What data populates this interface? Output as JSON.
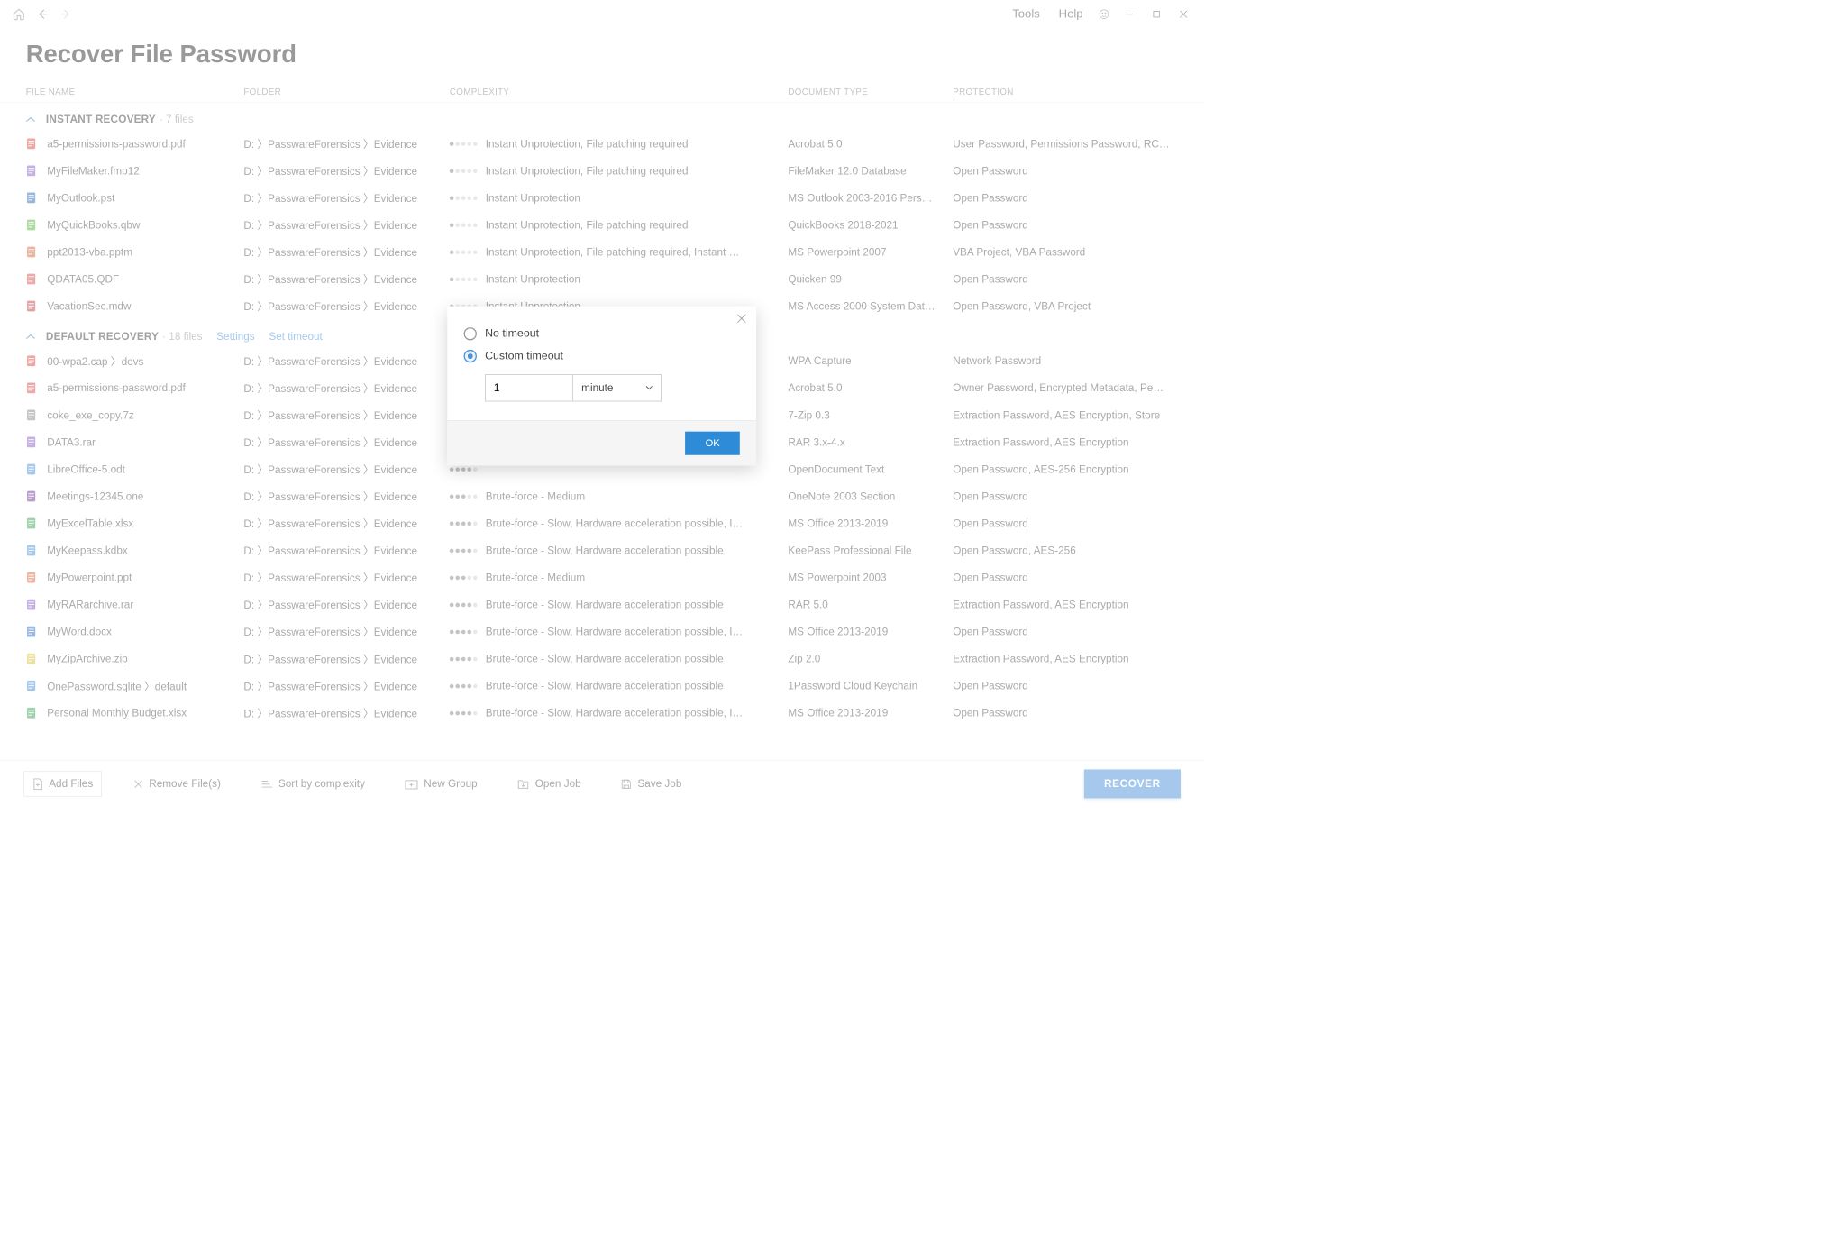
{
  "menu": {
    "tools": "Tools",
    "help": "Help"
  },
  "page_title": "Recover File Password",
  "columns": {
    "file_name": "FILE NAME",
    "folder": "FOLDER",
    "complexity": "COMPLEXITY",
    "document_type": "DOCUMENT TYPE",
    "protection": "PROTECTION"
  },
  "groups": [
    {
      "name": "INSTANT RECOVERY",
      "count": "· 7 files",
      "links": [],
      "rows": [
        {
          "icon": "pdf",
          "file": "a5-permissions-password.pdf",
          "folder": "D: 〉PasswareForensics 〉Evidence",
          "dots": 1,
          "complexity": "Instant Unprotection, File patching required",
          "doctype": "Acrobat 5.0",
          "protection": "User Password, Permissions Password, RC…"
        },
        {
          "icon": "filemaker",
          "file": "MyFileMaker.fmp12",
          "folder": "D: 〉PasswareForensics 〉Evidence",
          "dots": 1,
          "complexity": "Instant Unprotection, File patching required",
          "doctype": "FileMaker 12.0 Database",
          "protection": "Open Password"
        },
        {
          "icon": "outlook",
          "file": "MyOutlook.pst",
          "folder": "D: 〉PasswareForensics 〉Evidence",
          "dots": 1,
          "complexity": "Instant Unprotection",
          "doctype": "MS Outlook 2003-2016 Pers…",
          "protection": "Open Password"
        },
        {
          "icon": "qb",
          "file": "MyQuickBooks.qbw",
          "folder": "D: 〉PasswareForensics 〉Evidence",
          "dots": 1,
          "complexity": "Instant Unprotection, File patching required",
          "doctype": "QuickBooks 2018-2021",
          "protection": "Open Password"
        },
        {
          "icon": "ppt",
          "file": "ppt2013-vba.pptm",
          "folder": "D: 〉PasswareForensics 〉Evidence",
          "dots": 1,
          "complexity": "Instant Unprotection, File patching required, Instant …",
          "doctype": "MS Powerpoint 2007",
          "protection": "VBA Project, VBA Password"
        },
        {
          "icon": "quicken",
          "file": "QDATA05.QDF",
          "folder": "D: 〉PasswareForensics 〉Evidence",
          "dots": 1,
          "complexity": "Instant Unprotection",
          "doctype": "Quicken 99",
          "protection": "Open Password"
        },
        {
          "icon": "access",
          "file": "VacationSec.mdw",
          "folder": "D: 〉PasswareForensics 〉Evidence",
          "dots": 1,
          "complexity": "Instant Unprotection",
          "doctype": "MS Access 2000 System Dat…",
          "protection": "Open Password, VBA Project"
        }
      ]
    },
    {
      "name": "DEFAULT RECOVERY",
      "count": "· 18 files",
      "links": [
        "Settings",
        "Set timeout"
      ],
      "rows": [
        {
          "icon": "wifi",
          "file": "00-wpa2.cap 〉devs",
          "folder": "D: 〉PasswareForensics 〉Evidence",
          "dots": 4,
          "complexity": "",
          "doctype": "WPA Capture",
          "protection": "Network Password"
        },
        {
          "icon": "pdf",
          "file": "a5-permissions-password.pdf",
          "folder": "D: 〉PasswareForensics 〉Evidence",
          "dots": 4,
          "complexity": "",
          "doctype": "Acrobat 5.0",
          "protection": "Owner Password, Encrypted Metadata, Pe…"
        },
        {
          "icon": "archive",
          "file": "coke_exe_copy.7z",
          "folder": "D: 〉PasswareForensics 〉Evidence",
          "dots": 4,
          "complexity": "",
          "doctype": "7-Zip 0.3",
          "protection": "Extraction Password, AES Encryption, Store"
        },
        {
          "icon": "rar",
          "file": "DATA3.rar",
          "folder": "D: 〉PasswareForensics 〉Evidence",
          "dots": 4,
          "complexity": "",
          "doctype": "RAR 3.x-4.x",
          "protection": "Extraction Password, AES Encryption"
        },
        {
          "icon": "odt",
          "file": "LibreOffice-5.odt",
          "folder": "D: 〉PasswareForensics 〉Evidence",
          "dots": 4,
          "complexity": "",
          "doctype": "OpenDocument Text",
          "protection": "Open Password, AES-256 Encryption"
        },
        {
          "icon": "onenote",
          "file": "Meetings-12345.one",
          "folder": "D: 〉PasswareForensics 〉Evidence",
          "dots": 3,
          "complexity": "Brute-force - Medium",
          "doctype": "OneNote 2003 Section",
          "protection": "Open Password"
        },
        {
          "icon": "excel",
          "file": "MyExcelTable.xlsx",
          "folder": "D: 〉PasswareForensics 〉Evidence",
          "dots": 4,
          "complexity": "Brute-force - Slow, Hardware acceleration possible, I…",
          "doctype": "MS Office 2013-2019",
          "protection": "Open Password"
        },
        {
          "icon": "keepass",
          "file": "MyKeepass.kdbx",
          "folder": "D: 〉PasswareForensics 〉Evidence",
          "dots": 4,
          "complexity": "Brute-force - Slow, Hardware acceleration possible",
          "doctype": "KeePass Professional File",
          "protection": "Open Password, AES-256"
        },
        {
          "icon": "ppt",
          "file": "MyPowerpoint.ppt",
          "folder": "D: 〉PasswareForensics 〉Evidence",
          "dots": 3,
          "complexity": "Brute-force - Medium",
          "doctype": "MS Powerpoint 2003",
          "protection": "Open Password"
        },
        {
          "icon": "rar",
          "file": "MyRARarchive.rar",
          "folder": "D: 〉PasswareForensics 〉Evidence",
          "dots": 4,
          "complexity": "Brute-force - Slow, Hardware acceleration possible",
          "doctype": "RAR 5.0",
          "protection": "Extraction Password, AES Encryption"
        },
        {
          "icon": "word",
          "file": "MyWord.docx",
          "folder": "D: 〉PasswareForensics 〉Evidence",
          "dots": 4,
          "complexity": "Brute-force - Slow, Hardware acceleration possible, I…",
          "doctype": "MS Office 2013-2019",
          "protection": "Open Password"
        },
        {
          "icon": "zip",
          "file": "MyZipArchive.zip",
          "folder": "D: 〉PasswareForensics 〉Evidence",
          "dots": 4,
          "complexity": "Brute-force - Slow, Hardware acceleration possible",
          "doctype": "Zip 2.0",
          "protection": "Extraction Password, AES Encryption"
        },
        {
          "icon": "onepw",
          "file": "OnePassword.sqlite 〉default",
          "folder": "D: 〉PasswareForensics 〉Evidence",
          "dots": 4,
          "complexity": "Brute-force - Slow, Hardware acceleration possible",
          "doctype": "1Password Cloud Keychain",
          "protection": "Open Password"
        },
        {
          "icon": "excel",
          "file": "Personal Monthly Budget.xlsx",
          "folder": "D: 〉PasswareForensics 〉Evidence",
          "dots": 4,
          "complexity": "Brute-force - Slow, Hardware acceleration possible, I…",
          "doctype": "MS Office 2013-2019",
          "protection": "Open Password"
        }
      ]
    }
  ],
  "bottombar": {
    "add_files": "Add Files",
    "remove_files": "Remove File(s)",
    "sort": "Sort by complexity",
    "new_group": "New Group",
    "open_job": "Open Job",
    "save_job": "Save Job",
    "recover": "RECOVER"
  },
  "modal": {
    "no_timeout": "No timeout",
    "custom_timeout": "Custom timeout",
    "value": "1",
    "unit": "minute",
    "ok": "OK"
  },
  "icon_colors": {
    "pdf": "#d9534f",
    "filemaker": "#8a5fc7",
    "outlook": "#2e6fc2",
    "qb": "#5bb542",
    "ppt": "#d96b3f",
    "quicken": "#d9534f",
    "access": "#c2464a",
    "wifi": "#d9534f",
    "archive": "#8a8a8a",
    "rar": "#8a5fc7",
    "odt": "#4a90d9",
    "onenote": "#7a3f9d",
    "excel": "#3aa655",
    "keepass": "#4a90d9",
    "word": "#2e6fc2",
    "zip": "#d9c13f",
    "onepw": "#4a90d9"
  }
}
